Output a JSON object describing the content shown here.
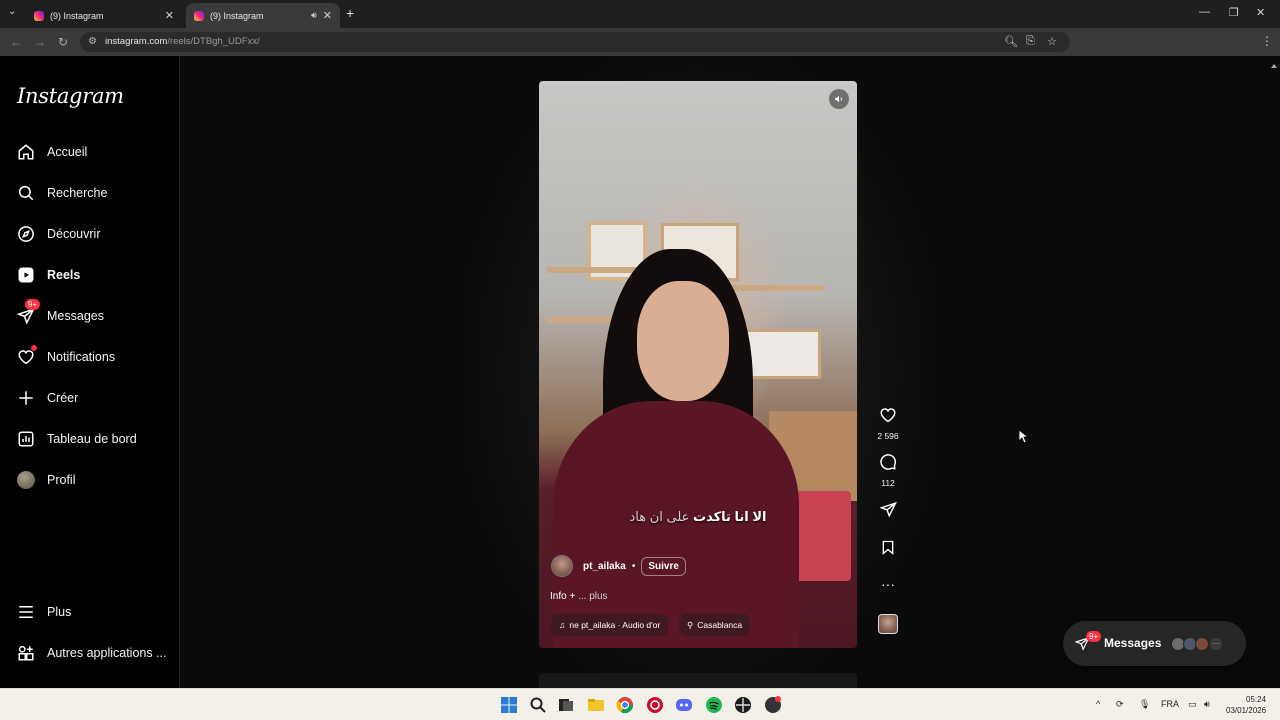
{
  "browser": {
    "tabs": [
      {
        "title": "(9) Instagram",
        "active": false
      },
      {
        "title": "(9) Instagram",
        "active": true
      }
    ],
    "url_host": "instagram.com",
    "url_path": "/reels/DTBgh_UDFxx/"
  },
  "sidebar": {
    "logo": "Instagram",
    "items": [
      {
        "label": "Accueil",
        "icon": "home-icon"
      },
      {
        "label": "Recherche",
        "icon": "search-icon"
      },
      {
        "label": "Découvrir",
        "icon": "compass-icon"
      },
      {
        "label": "Reels",
        "icon": "reels-icon",
        "active": true
      },
      {
        "label": "Messages",
        "icon": "messenger-icon",
        "badge": "9+"
      },
      {
        "label": "Notifications",
        "icon": "heart-icon"
      },
      {
        "label": "Créer",
        "icon": "plus-icon"
      },
      {
        "label": "Tableau de bord",
        "icon": "dashboard-icon"
      },
      {
        "label": "Profil",
        "icon": "avatar"
      }
    ],
    "bottom_items": [
      {
        "label": "Plus",
        "icon": "menu-icon"
      },
      {
        "label": "Autres applications ...",
        "icon": "apps-icon"
      }
    ]
  },
  "reel": {
    "caption_bold": "الا انا تاكدت",
    "caption_rest": "على ان هاد",
    "author": "pt_ailaka",
    "separator": "•",
    "follow_label": "Suivre",
    "info_text": "Info +",
    "info_more": "... plus",
    "audio_chip": "ne  pt_ailaka · Audio d'or",
    "location_chip": "Casablanca"
  },
  "actions": {
    "likes": "2 596",
    "comments": "112"
  },
  "messages_pill": {
    "label": "Messages",
    "badge": "9+"
  },
  "taskbar": {
    "language": "FRA",
    "time": "05:24",
    "date": "03/01/2026"
  },
  "colors": {
    "accent_badge": "#ff3040",
    "sidebar_bg": "#000000",
    "page_bg": "#0b0b0b"
  }
}
